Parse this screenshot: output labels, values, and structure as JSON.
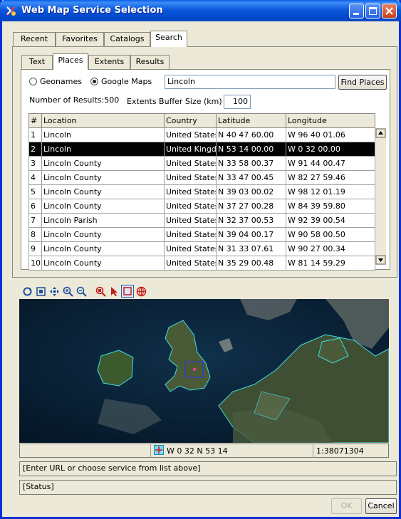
{
  "window": {
    "title": "Web Map Service Selection"
  },
  "main_tabs": [
    "Recent",
    "Favorites",
    "Catalogs",
    "Search"
  ],
  "sub_tabs": [
    "Text",
    "Places",
    "Extents",
    "Results"
  ],
  "search": {
    "source_geonames": "Geonames",
    "source_google": "Google Maps",
    "place_query": "Lincoln",
    "find_button": "Find Places",
    "results_label": "Number of Results:500",
    "buffer_label": "Extents Buffer Size (km)",
    "buffer_value": "100"
  },
  "table": {
    "headers": [
      "#",
      "Location",
      "Country",
      "Latitude",
      "Longitude"
    ],
    "rows": [
      [
        "1",
        "Lincoln",
        "United States",
        "N 40 47 60.00",
        "W 96 40 01.06"
      ],
      [
        "2",
        "Lincoln",
        "United Kingdom",
        "N 53 14 00.00",
        "W 0 32 00.00"
      ],
      [
        "3",
        "Lincoln County",
        "United States",
        "N 33 58 00.37",
        "W 91 44 00.47"
      ],
      [
        "4",
        "Lincoln County",
        "United States",
        "N 33 47 00.45",
        "W 82 27 59.46"
      ],
      [
        "5",
        "Lincoln County",
        "United States",
        "N 39 03 00.02",
        "W 98 12 01.19"
      ],
      [
        "6",
        "Lincoln County",
        "United States",
        "N 37 27 00.28",
        "W 84 39 59.80"
      ],
      [
        "7",
        "Lincoln Parish",
        "United States",
        "N 32 37 00.53",
        "W 92 39 00.54"
      ],
      [
        "8",
        "Lincoln County",
        "United States",
        "N 39 04 00.17",
        "W 90 58 00.50"
      ],
      [
        "9",
        "Lincoln County",
        "United States",
        "N 31 33 07.61",
        "W 90 27 00.34"
      ],
      [
        "10",
        "Lincoln County",
        "United States",
        "N 35 29 00.48",
        "W 81 14 59.29"
      ]
    ],
    "selected_row": 1
  },
  "map_tools": [
    "refresh-icon",
    "full-extent-icon",
    "pan-icon",
    "zoom-in-icon",
    "zoom-out-icon",
    "zoom-region-icon",
    "select-arrow-icon",
    "rectangle-select-icon",
    "globe-icon"
  ],
  "status": {
    "coords": "W 0 32  N 53 14",
    "scale": "1:38071304",
    "url_prompt": "[Enter URL or choose service from list above]",
    "status_text": "[Status]"
  },
  "buttons": {
    "ok": "OK",
    "cancel": "Cancel"
  },
  "colors": {
    "title_bar": "#0b58dc",
    "selected_row": "#000000",
    "map_border": "#3fe0e0"
  }
}
